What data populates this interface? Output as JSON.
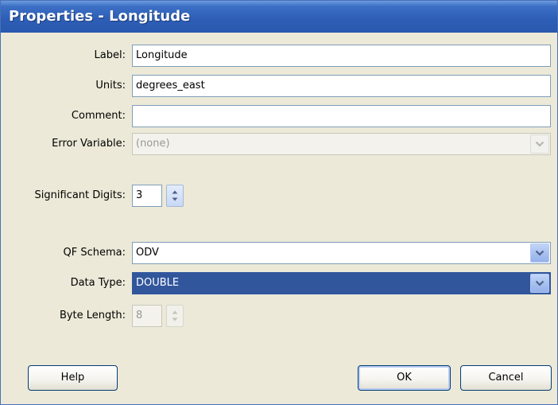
{
  "window": {
    "title": "Properties - Longitude"
  },
  "form": {
    "label": {
      "label": "Label:",
      "value": "Longitude"
    },
    "units": {
      "label": "Units:",
      "value": "degrees_east"
    },
    "comment": {
      "label": "Comment:",
      "value": ""
    },
    "error_variable": {
      "label": "Error Variable:",
      "value": "(none)"
    },
    "significant_digits": {
      "label": "Significant Digits:",
      "value": "3"
    },
    "qf_schema": {
      "label": "QF Schema:",
      "value": "ODV"
    },
    "data_type": {
      "label": "Data Type:",
      "value": "DOUBLE"
    },
    "byte_length": {
      "label": "Byte Length:",
      "value": "8"
    }
  },
  "buttons": {
    "help": "Help",
    "ok": "OK",
    "cancel": "Cancel"
  },
  "icons": {
    "dropdown": "chevron-down-icon",
    "spinner_up": "triangle-up-icon",
    "spinner_down": "triangle-down-icon"
  },
  "colors": {
    "titlebar": "#2d5db5",
    "window_bg": "#ece9d8",
    "selection": "#31569c",
    "input_border": "#7f9db9"
  }
}
